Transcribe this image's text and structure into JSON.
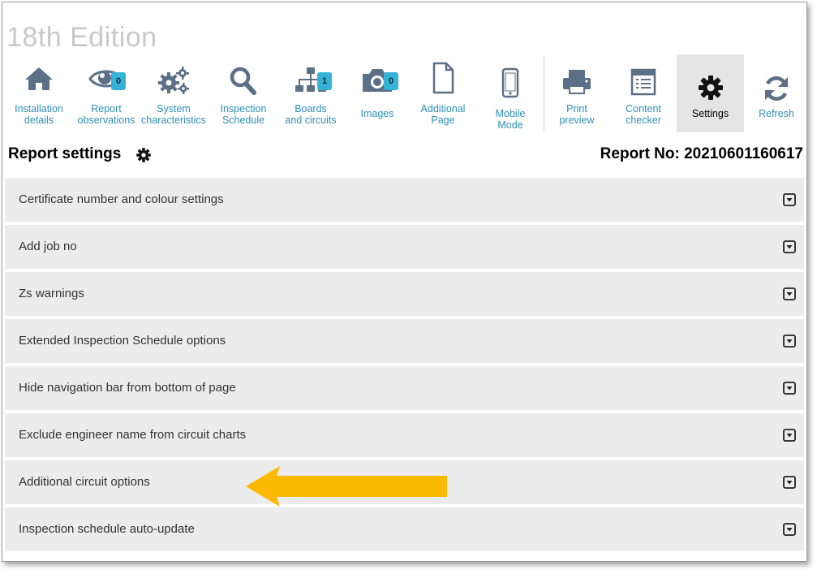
{
  "app_title": "18th Edition",
  "toolbar": [
    {
      "id": "installation",
      "line1": "Installation",
      "line2": "details",
      "icon": "home-icon"
    },
    {
      "id": "observations",
      "line1": "Report",
      "line2": "observations",
      "icon": "eye-icon",
      "badge": "0"
    },
    {
      "id": "system",
      "line1": "System",
      "line2": "characteristics",
      "icon": "gears-icon"
    },
    {
      "id": "inspection",
      "line1": "Inspection",
      "line2": "Schedule",
      "icon": "search-icon"
    },
    {
      "id": "boards",
      "line1": "Boards",
      "line2": "and circuits",
      "icon": "sitemap-icon",
      "badge": "1"
    },
    {
      "id": "images",
      "line1": "Images",
      "line2": "",
      "icon": "camera-icon",
      "badge": "0"
    },
    {
      "id": "additional",
      "line1": "Additional",
      "line2": "Page",
      "icon": "file-icon"
    },
    {
      "id": "mobile",
      "line1": "Mobile",
      "line2": "Mode",
      "icon": "mobile-icon"
    },
    {
      "id": "print",
      "line1": "Print",
      "line2": "preview",
      "icon": "print-icon"
    },
    {
      "id": "content",
      "line1": "Content",
      "line2": "checker",
      "icon": "checklist-icon"
    },
    {
      "id": "settings",
      "line1": "Settings",
      "line2": "",
      "icon": "gear-icon",
      "active": true
    },
    {
      "id": "refresh",
      "line1": "Refresh",
      "line2": "",
      "icon": "refresh-icon"
    }
  ],
  "header": {
    "title": "Report settings",
    "report_no": "Report No: 20210601160617"
  },
  "settings_sections": [
    "Certificate number and colour settings",
    "Add job no",
    "Zs warnings",
    "Extended Inspection Schedule options",
    "Hide navigation bar from bottom of page",
    "Exclude engineer name from circuit charts",
    "Additional circuit options",
    "Inspection schedule auto-update"
  ],
  "colors": {
    "toolbar_icon": "#5b6f86",
    "toolbar_text": "#2e8fb8",
    "badge": "#36b2d8",
    "row_bg": "#ececec",
    "arrow": "#fbb900"
  }
}
